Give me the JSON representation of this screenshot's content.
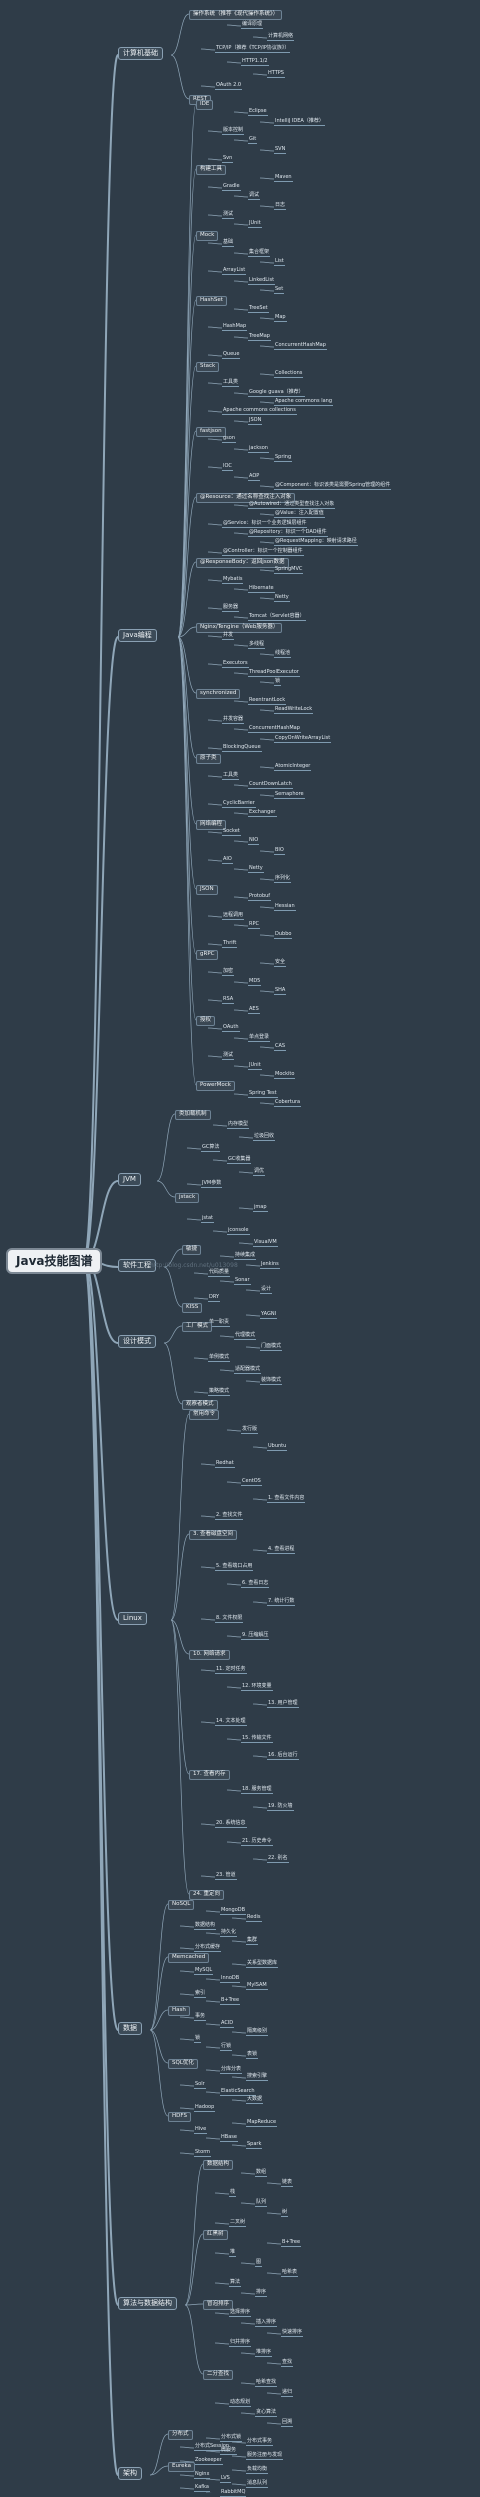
{
  "root": "Java技能图谱",
  "watermark": "http://blog.csdn.net/u013098",
  "sections": {
    "computer_basics": {
      "label": "计算机基础",
      "items": [
        "操作系统（推荐《现代操作系统》）",
        "编译原理",
        "计算机网络",
        "TCP/IP（推荐《TCP/IP协议族》）",
        "HTTP1.1/2",
        "HTTPS",
        "OAuth 2.0",
        "REST"
      ]
    },
    "java_programming": {
      "label": "Java编程",
      "items": [
        "IDE",
        "Eclipse",
        "IntelliJ IDEA（推荐）",
        "版本控制",
        "Git",
        "SVN",
        "Svn",
        "构建工具",
        "Maven",
        "Gradle",
        "调试",
        "日志",
        "测试",
        "JUnit",
        "Mock",
        "基础",
        "集合框架",
        "List",
        "ArrayList",
        "LinkedList",
        "Set",
        "HashSet",
        "TreeSet",
        "Map",
        "HashMap",
        "TreeMap",
        "ConcurrentHashMap",
        "Queue",
        "Stack",
        "Collections",
        "工具类",
        "Google guava（推荐）",
        "Apache commons lang",
        "Apache commons collections",
        "JSON",
        "fastjson",
        "gson",
        "jackson",
        "Spring",
        "IOC",
        "AOP",
        "@Component：标识该类是需要Spring管理的组件",
        "@Resource：通过名称查找注入对象",
        "@Autowired：通过类型查找注入对象",
        "@Value：注入配置值",
        "@Service：标识一个业务逻辑层组件",
        "@Repository：标识一个DAO组件",
        "@RequestMapping：映射请求路径",
        "@Controller：标识一个控制器组件",
        "@ResponseBody：返回json数据",
        "SpringMVC",
        "Mybatis",
        "Hibernate",
        "Netty",
        "服务器",
        "Tomcat（Servlet容器）",
        "Nginx/Tengine（Web服务器）",
        "并发",
        "多线程",
        "线程池",
        "Executors",
        "ThreadPoolExecutor",
        "锁",
        "synchronized",
        "ReentrantLock",
        "ReadWriteLock",
        "并发容器",
        "ConcurrentHashMap",
        "CopyOnWriteArrayList",
        "BlockingQueue",
        "原子类",
        "AtomicInteger",
        "工具类",
        "CountDownLatch",
        "Semaphore",
        "CyclicBarrier",
        "Exchanger",
        "网络编程",
        "Socket",
        "NIO",
        "BIO",
        "AIO",
        "Netty",
        "序列化",
        "JSON",
        "Protobuf",
        "Hessian",
        "远程调用",
        "RPC",
        "Dubbo",
        "Thrift",
        "gRPC",
        "安全",
        "加密",
        "MD5",
        "SHA",
        "RSA",
        "AES",
        "授权",
        "OAuth",
        "单点登录",
        "CAS",
        "测试",
        "JUnit",
        "Mockito",
        "PowerMock",
        "Spring Test",
        "Cobertura"
      ]
    },
    "jvm": {
      "label": "JVM",
      "items": [
        "类加载机制",
        "内存模型",
        "垃圾回收",
        "GC算法",
        "GC收集器",
        "调优",
        "JVM参数",
        "jstack",
        "jmap",
        "jstat",
        "jconsole",
        "VisualVM"
      ]
    },
    "software_engineering": {
      "label": "软件工程",
      "items": [
        "敏捷",
        "持续集成",
        "Jenkins",
        "代码质量",
        "Sonar",
        "设计",
        "DRY",
        "KISS",
        "YAGNI",
        "单一职责"
      ]
    },
    "design_patterns": {
      "label": "设计模式",
      "items": [
        "工厂模式",
        "代理模式",
        "门面模式",
        "单例模式",
        "适配器模式",
        "装饰模式",
        "策略模式",
        "观察者模式"
      ]
    },
    "linux": {
      "label": "Linux",
      "items": [
        "常用命令",
        "发行版",
        "Ubuntu",
        "Redhat",
        "CentOS",
        "1. 查看文件内容",
        "2. 查找文件",
        "3. 查看磁盘空间",
        "4. 查看进程",
        "5. 查看端口占用",
        "6. 查看日志",
        "7. 统计行数",
        "8. 文件权限",
        "9. 压缩解压",
        "10. 网络请求",
        "11. 定时任务",
        "12. 环境变量",
        "13. 用户管理",
        "14. 文本处理",
        "15. 传输文件",
        "16. 后台运行",
        "17. 查看内存",
        "18. 服务管理",
        "19. 防火墙",
        "20. 系统信息",
        "21. 历史命令",
        "22. 别名",
        "23. 管道",
        "24. 重定向"
      ]
    },
    "database": {
      "label": "数据",
      "items": [
        "NoSQL",
        "MongoDB",
        "Redis",
        "数据结构",
        "持久化",
        "集群",
        "分布式缓存",
        "Memcached",
        "关系型数据库",
        "MySQL",
        "InnoDB",
        "MyISAM",
        "索引",
        "B+Tree",
        "Hash",
        "事务",
        "ACID",
        "隔离级别",
        "锁",
        "行锁",
        "表锁",
        "SQL优化",
        "分库分表",
        "搜索引擎",
        "Solr",
        "ElasticSearch",
        "大数据",
        "Hadoop",
        "HDFS",
        "MapReduce",
        "Hive",
        "HBase",
        "Spark",
        "Storm"
      ]
    },
    "algorithms": {
      "label": "算法与数据结构",
      "items": [
        "数据结构",
        "数组",
        "链表",
        "栈",
        "队列",
        "树",
        "二叉树",
        "红黑树",
        "B+Tree",
        "堆",
        "图",
        "哈希表",
        "算法",
        "排序",
        "冒泡排序",
        "选择排序",
        "插入排序",
        "快速排序",
        "归并排序",
        "堆排序",
        "查找",
        "二分查找",
        "哈希查找",
        "递归",
        "动态规划",
        "贪心算法",
        "回溯"
      ]
    },
    "architecture": {
      "label": "架构",
      "items": [
        "分布式",
        "分布式锁",
        "分布式事务",
        "分布式Session",
        "微服务",
        "服务注册与发现",
        "Zookeeper",
        "Eureka",
        "负载均衡",
        "Nginx",
        "LVS",
        "消息队列",
        "Kafka",
        "RabbitMQ"
      ]
    }
  }
}
